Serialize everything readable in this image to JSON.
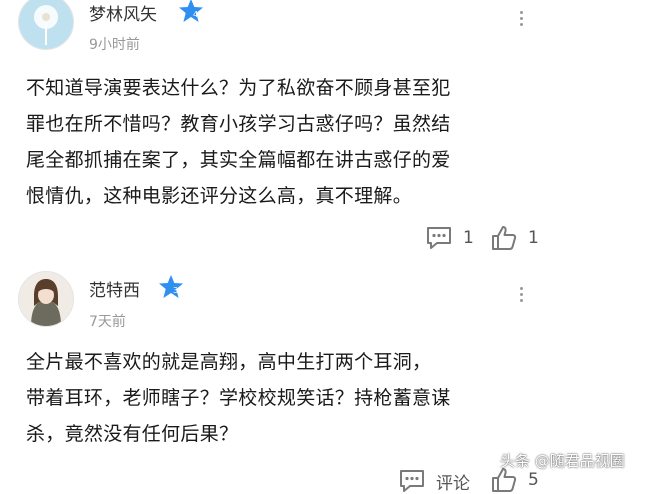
{
  "comments": [
    {
      "username": "梦林风矢",
      "badge_level": "4",
      "time": "9小时前",
      "text_lines": [
        "不知道导演要表达什么？为了私欲奋不顾身甚至犯",
        "罪也在所不惜吗？教育小孩学习古惑仔吗？虽然结",
        "尾全都抓捕在案了，其实全篇幅都在讲古惑仔的爱",
        "恨情仇，这种电影还评分这么高，真不理解。"
      ],
      "reply_count": "1",
      "like_count": "1"
    },
    {
      "username": "范特西",
      "badge_level": "3",
      "time": "7天前",
      "text_lines": [
        "全片最不喜欢的就是高翔，高中生打两个耳洞，",
        "带着耳环，老师瞎子？学校校规笑话？持枪蓄意谋",
        "杀，竟然没有任何后果？"
      ],
      "reply_label": "评论",
      "like_count": "5"
    }
  ],
  "watermark": "头条 @随君品视圈",
  "colors": {
    "badge": "#2f8ff0",
    "icon": "#7a7a7a",
    "text": "#1a1a1a",
    "meta": "#999999"
  }
}
